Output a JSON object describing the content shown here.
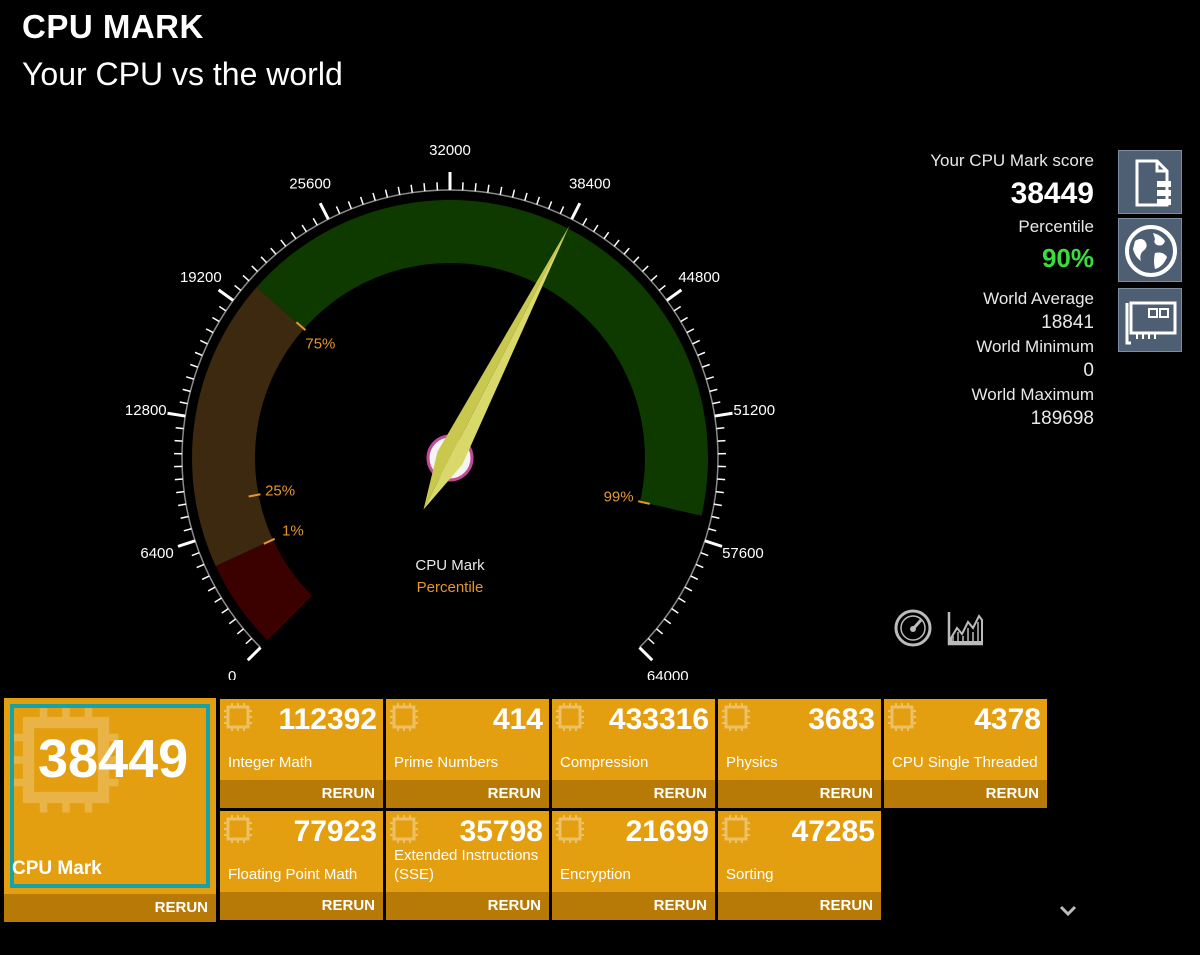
{
  "header": {
    "title": "CPU MARK",
    "subtitle": "Your CPU vs the world"
  },
  "gauge": {
    "min": 0,
    "max": 64000,
    "value": 38449,
    "major_ticks": [
      "0",
      "6400",
      "12800",
      "19200",
      "25600",
      "32000",
      "38400",
      "44800",
      "51200",
      "57600",
      "64000"
    ],
    "percentile_marks": [
      {
        "label": "1%",
        "at": 4800
      },
      {
        "label": "25%",
        "at": 8100
      },
      {
        "label": "75%",
        "at": 20500
      },
      {
        "label": "99%",
        "at": 56400
      }
    ],
    "bands": [
      {
        "from": 0,
        "to": 4800,
        "color": "#3b0000"
      },
      {
        "from": 4800,
        "to": 20500,
        "color": "#3d2810"
      },
      {
        "from": 20500,
        "to": 56400,
        "color": "#0e3a00"
      }
    ],
    "center_label": "CPU Mark",
    "center_sublabel": "Percentile",
    "colors": {
      "needle": "#d9d86a",
      "tick": "#ffffff",
      "percentile": "#e5962d"
    }
  },
  "summary": {
    "score_label": "Your CPU Mark score",
    "score": "38449",
    "percentile_label": "Percentile",
    "percentile": "90%",
    "world_average_label": "World Average",
    "world_average": "18841",
    "world_minimum_label": "World Minimum",
    "world_minimum": "0",
    "world_maximum_label": "World Maximum",
    "world_maximum": "189698"
  },
  "side_buttons": [
    "document-icon",
    "globe-icon",
    "hardware-card-icon"
  ],
  "tools": [
    "speedometer-icon",
    "chart-icon"
  ],
  "tiles": {
    "main": {
      "score": "38449",
      "name": "CPU Mark",
      "rerun": "RERUN"
    },
    "items": [
      {
        "score": "112392",
        "name": "Integer Math",
        "rerun": "RERUN"
      },
      {
        "score": "414",
        "name": "Prime Numbers",
        "rerun": "RERUN"
      },
      {
        "score": "433316",
        "name": "Compression",
        "rerun": "RERUN"
      },
      {
        "score": "3683",
        "name": "Physics",
        "rerun": "RERUN"
      },
      {
        "score": "4378",
        "name": "CPU Single Threaded",
        "rerun": "RERUN"
      },
      {
        "score": "77923",
        "name": "Floating Point Math",
        "rerun": "RERUN"
      },
      {
        "score": "35798",
        "name": "Extended Instructions (SSE)",
        "rerun": "RERUN"
      },
      {
        "score": "21699",
        "name": "Encryption",
        "rerun": "RERUN"
      },
      {
        "score": "47285",
        "name": "Sorting",
        "rerun": "RERUN"
      }
    ]
  },
  "colors": {
    "tile": "#e39f10",
    "tile_footer": "#b87a06",
    "main_border": "#17a3a6",
    "percentile_text": "#3ddc3d"
  }
}
